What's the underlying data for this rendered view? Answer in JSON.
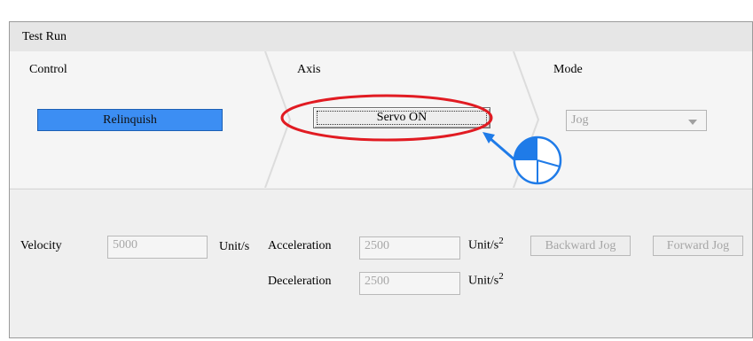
{
  "window": {
    "title": "Test Run"
  },
  "steps": {
    "control": {
      "label": "Control",
      "button": "Relinquish"
    },
    "axis": {
      "label": "Axis",
      "button": "Servo ON"
    },
    "mode": {
      "label": "Mode",
      "selected": "Jog"
    }
  },
  "params": {
    "velocity": {
      "label": "Velocity",
      "value": "5000",
      "unit": "Unit/s"
    },
    "acceleration": {
      "label": "Acceleration",
      "value": "2500",
      "unit": "Unit/s",
      "unit_exp": "2"
    },
    "deceleration": {
      "label": "Deceleration",
      "value": "2500",
      "unit": "Unit/s",
      "unit_exp": "2"
    }
  },
  "jog": {
    "backward": "Backward Jog",
    "forward": "Forward Jog"
  },
  "colors": {
    "relinquish_bg": "#3c8ef3",
    "highlight": "#e11b22",
    "pointer": "#1f7be8"
  },
  "annotation": {
    "highlight_icon": "click-pointer-icon"
  }
}
